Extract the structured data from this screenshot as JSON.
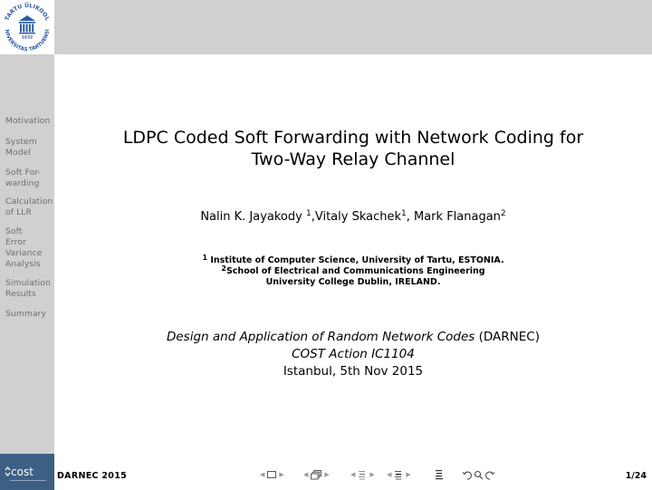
{
  "header": {
    "logo_name": "University of Tartu logo",
    "logo_text_top": "TARTU ÜLIKOOL",
    "logo_text_bottom": "UNIVERSITAS TARTUENSIS",
    "logo_year": "1632"
  },
  "sidebar": {
    "items": [
      {
        "lines": [
          "Motivation"
        ]
      },
      {
        "lines": [
          "System",
          "Model"
        ]
      },
      {
        "lines": [
          "Soft For-",
          "warding"
        ]
      },
      {
        "lines": [
          "Calculation",
          "of LLR"
        ]
      },
      {
        "lines": [
          "Soft",
          "Error",
          "Variance",
          "Analysis"
        ]
      },
      {
        "lines": [
          "Simulation",
          "Results"
        ]
      },
      {
        "lines": [
          "Summary"
        ]
      }
    ],
    "bottom_logo": "cost"
  },
  "slide": {
    "title_line1": "LDPC Coded Soft Forwarding with Network Coding for",
    "title_line2": "Two-Way Relay Channel",
    "authors": [
      {
        "name": "Nalin K. Jayakody ",
        "mark": "1",
        "sep": ","
      },
      {
        "name": "Vitaly Skachek",
        "mark": "1",
        "sep": ", "
      },
      {
        "name": "Mark Flanagan",
        "mark": "2",
        "sep": ""
      }
    ],
    "affiliations": {
      "mark1": "1",
      "line1": " Institute of Computer Science, University of Tartu, ESTONIA.",
      "mark2": "2",
      "line2": "School of Electrical and Communications Engineering",
      "line3": "University College Dublin, IRELAND."
    },
    "event": {
      "project_italic": "Design and Application of Random Network Codes",
      "project_abbr": " (DARNEC)",
      "action": "COST Action IC1104",
      "place_date": "Istanbul, 5th Nov 2015"
    }
  },
  "footer": {
    "short_title": "DARNEC 2015",
    "page": "1/24",
    "nav_icons": [
      "prev-arrow",
      "frame-icon",
      "next-arrow",
      "prev-arrow",
      "subsection-icon",
      "next-arrow",
      "prev-arrow",
      "section-icon",
      "next-arrow",
      "prev-arrow",
      "document-icon",
      "next-arrow",
      "appendix-icon",
      "back-icon",
      "search-icon",
      "forward-icon"
    ]
  },
  "colors": {
    "bar_gray": "#d0d0d0",
    "sidebar_text": "#6e6e6e",
    "cost_blue": "#3e5f84",
    "ut_blue": "#2a5ba8"
  }
}
